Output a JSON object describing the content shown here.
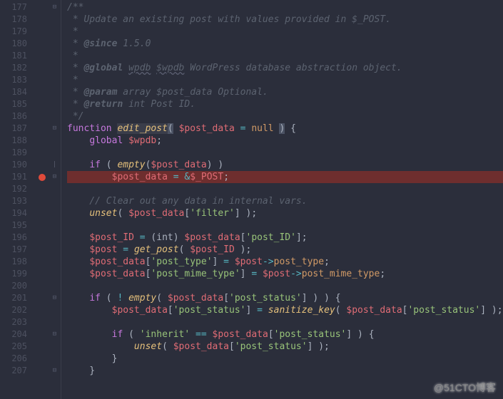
{
  "watermark": "@51CTO博客",
  "gutter": {
    "start": 177,
    "end": 207,
    "breakpoint_lines": [
      191
    ],
    "fold_markers": {
      "177": "⊟",
      "187": "⊟",
      "190": "|",
      "191": "⊟",
      "201": "⊟",
      "204": "⊟",
      "207": "⊟"
    }
  },
  "code": {
    "177": [
      {
        "c": "c-comment",
        "t": "/**"
      }
    ],
    "178": [
      {
        "c": "c-comment",
        "t": " * Update an existing post with values provided in $_POST."
      }
    ],
    "179": [
      {
        "c": "c-comment",
        "t": " *"
      }
    ],
    "180": [
      {
        "c": "c-comment",
        "t": " * "
      },
      {
        "c": "c-tag",
        "t": "@since"
      },
      {
        "c": "c-comment",
        "t": " 1.5.0"
      }
    ],
    "181": [
      {
        "c": "c-comment",
        "t": " *"
      }
    ],
    "182": [
      {
        "c": "c-comment",
        "t": " * "
      },
      {
        "c": "c-tag",
        "t": "@global"
      },
      {
        "c": "c-comment",
        "t": " "
      },
      {
        "c": "c-comment underline",
        "t": "wpdb"
      },
      {
        "c": "c-comment",
        "t": " "
      },
      {
        "c": "c-comment underline",
        "t": "$wpdb"
      },
      {
        "c": "c-comment",
        "t": " WordPress database abstraction object."
      }
    ],
    "183": [
      {
        "c": "c-comment",
        "t": " *"
      }
    ],
    "184": [
      {
        "c": "c-comment",
        "t": " * "
      },
      {
        "c": "c-tag",
        "t": "@param"
      },
      {
        "c": "c-comment",
        "t": " array $post_data Optional."
      }
    ],
    "185": [
      {
        "c": "c-comment",
        "t": " * "
      },
      {
        "c": "c-tag",
        "t": "@return"
      },
      {
        "c": "c-comment",
        "t": " int Post ID."
      }
    ],
    "186": [
      {
        "c": "c-comment",
        "t": " */"
      }
    ],
    "187": [
      {
        "c": "c-kw",
        "t": "function"
      },
      {
        "c": "c-punc",
        "t": " "
      },
      {
        "c": "c-fnname",
        "t": "edit_post"
      },
      {
        "c": "c-punc c-paren-hl",
        "t": "("
      },
      {
        "c": "c-punc",
        "t": " "
      },
      {
        "c": "c-var",
        "t": "$post_data"
      },
      {
        "c": "c-punc",
        "t": " "
      },
      {
        "c": "c-op",
        "t": "="
      },
      {
        "c": "c-punc",
        "t": " "
      },
      {
        "c": "c-null",
        "t": "null"
      },
      {
        "c": "c-punc",
        "t": " "
      },
      {
        "c": "c-punc c-paren-hl",
        "t": ")"
      },
      {
        "c": "c-punc",
        "t": " {"
      }
    ],
    "188": [
      {
        "c": "c-punc",
        "t": "    "
      },
      {
        "c": "c-kw",
        "t": "global"
      },
      {
        "c": "c-punc",
        "t": " "
      },
      {
        "c": "c-var",
        "t": "$wpdb"
      },
      {
        "c": "c-punc",
        "t": ";"
      }
    ],
    "189": [],
    "190": [
      {
        "c": "c-punc",
        "t": "    "
      },
      {
        "c": "c-kw",
        "t": "if"
      },
      {
        "c": "c-punc",
        "t": " ( "
      },
      {
        "c": "c-fn",
        "t": "empty"
      },
      {
        "c": "c-punc",
        "t": "("
      },
      {
        "c": "c-var",
        "t": "$post_data"
      },
      {
        "c": "c-punc",
        "t": ") )"
      }
    ],
    "191": [
      {
        "c": "c-punc",
        "t": "        "
      },
      {
        "c": "c-var",
        "t": "$post_data"
      },
      {
        "c": "c-punc",
        "t": " "
      },
      {
        "c": "c-op",
        "t": "="
      },
      {
        "c": "c-punc",
        "t": " "
      },
      {
        "c": "c-op",
        "t": "&"
      },
      {
        "c": "c-var",
        "t": "$_POST"
      },
      {
        "c": "c-punc",
        "t": ";"
      }
    ],
    "192": [],
    "193": [
      {
        "c": "c-comment",
        "t": "    // Clear out any data in internal vars."
      }
    ],
    "194": [
      {
        "c": "c-punc",
        "t": "    "
      },
      {
        "c": "c-fn",
        "t": "unset"
      },
      {
        "c": "c-punc",
        "t": "( "
      },
      {
        "c": "c-var",
        "t": "$post_data"
      },
      {
        "c": "c-punc",
        "t": "["
      },
      {
        "c": "c-str",
        "t": "'filter'"
      },
      {
        "c": "c-punc",
        "t": "] );"
      }
    ],
    "195": [],
    "196": [
      {
        "c": "c-punc",
        "t": "    "
      },
      {
        "c": "c-var",
        "t": "$post_ID"
      },
      {
        "c": "c-punc",
        "t": " "
      },
      {
        "c": "c-op",
        "t": "="
      },
      {
        "c": "c-punc",
        "t": " (int) "
      },
      {
        "c": "c-var",
        "t": "$post_data"
      },
      {
        "c": "c-punc",
        "t": "["
      },
      {
        "c": "c-str",
        "t": "'post_ID'"
      },
      {
        "c": "c-punc",
        "t": "];"
      }
    ],
    "197": [
      {
        "c": "c-punc",
        "t": "    "
      },
      {
        "c": "c-var",
        "t": "$post"
      },
      {
        "c": "c-punc",
        "t": " "
      },
      {
        "c": "c-op",
        "t": "="
      },
      {
        "c": "c-punc",
        "t": " "
      },
      {
        "c": "c-fn",
        "t": "get_post"
      },
      {
        "c": "c-punc",
        "t": "( "
      },
      {
        "c": "c-var",
        "t": "$post_ID"
      },
      {
        "c": "c-punc",
        "t": " );"
      }
    ],
    "198": [
      {
        "c": "c-punc",
        "t": "    "
      },
      {
        "c": "c-var",
        "t": "$post_data"
      },
      {
        "c": "c-punc",
        "t": "["
      },
      {
        "c": "c-str",
        "t": "'post_type'"
      },
      {
        "c": "c-punc",
        "t": "] "
      },
      {
        "c": "c-op",
        "t": "="
      },
      {
        "c": "c-punc",
        "t": " "
      },
      {
        "c": "c-var",
        "t": "$post"
      },
      {
        "c": "c-op",
        "t": "->"
      },
      {
        "c": "c-var2",
        "t": "post_type"
      },
      {
        "c": "c-punc",
        "t": ";"
      }
    ],
    "199": [
      {
        "c": "c-punc",
        "t": "    "
      },
      {
        "c": "c-var",
        "t": "$post_data"
      },
      {
        "c": "c-punc",
        "t": "["
      },
      {
        "c": "c-str",
        "t": "'post_mime_type'"
      },
      {
        "c": "c-punc",
        "t": "] "
      },
      {
        "c": "c-op",
        "t": "="
      },
      {
        "c": "c-punc",
        "t": " "
      },
      {
        "c": "c-var",
        "t": "$post"
      },
      {
        "c": "c-op",
        "t": "->"
      },
      {
        "c": "c-var2",
        "t": "post_mime_type"
      },
      {
        "c": "c-punc",
        "t": ";"
      }
    ],
    "200": [],
    "201": [
      {
        "c": "c-punc",
        "t": "    "
      },
      {
        "c": "c-kw",
        "t": "if"
      },
      {
        "c": "c-punc",
        "t": " ( "
      },
      {
        "c": "c-op",
        "t": "!"
      },
      {
        "c": "c-punc",
        "t": " "
      },
      {
        "c": "c-fn",
        "t": "empty"
      },
      {
        "c": "c-punc",
        "t": "( "
      },
      {
        "c": "c-var",
        "t": "$post_data"
      },
      {
        "c": "c-punc",
        "t": "["
      },
      {
        "c": "c-str",
        "t": "'post_status'"
      },
      {
        "c": "c-punc",
        "t": "] ) ) {"
      }
    ],
    "202": [
      {
        "c": "c-punc",
        "t": "        "
      },
      {
        "c": "c-var",
        "t": "$post_data"
      },
      {
        "c": "c-punc",
        "t": "["
      },
      {
        "c": "c-str",
        "t": "'post_status'"
      },
      {
        "c": "c-punc",
        "t": "] "
      },
      {
        "c": "c-op",
        "t": "="
      },
      {
        "c": "c-punc",
        "t": " "
      },
      {
        "c": "c-fn",
        "t": "sanitize_key"
      },
      {
        "c": "c-punc",
        "t": "( "
      },
      {
        "c": "c-var",
        "t": "$post_data"
      },
      {
        "c": "c-punc",
        "t": "["
      },
      {
        "c": "c-str",
        "t": "'post_status'"
      },
      {
        "c": "c-punc",
        "t": "] );"
      }
    ],
    "203": [],
    "204": [
      {
        "c": "c-punc",
        "t": "        "
      },
      {
        "c": "c-kw",
        "t": "if"
      },
      {
        "c": "c-punc",
        "t": " ( "
      },
      {
        "c": "c-str",
        "t": "'inherit'"
      },
      {
        "c": "c-punc",
        "t": " "
      },
      {
        "c": "c-op",
        "t": "=="
      },
      {
        "c": "c-punc",
        "t": " "
      },
      {
        "c": "c-var",
        "t": "$post_data"
      },
      {
        "c": "c-punc",
        "t": "["
      },
      {
        "c": "c-str",
        "t": "'post_status'"
      },
      {
        "c": "c-punc",
        "t": "] ) {"
      }
    ],
    "205": [
      {
        "c": "c-punc",
        "t": "            "
      },
      {
        "c": "c-fn",
        "t": "unset"
      },
      {
        "c": "c-punc",
        "t": "( "
      },
      {
        "c": "c-var",
        "t": "$post_data"
      },
      {
        "c": "c-punc",
        "t": "["
      },
      {
        "c": "c-str",
        "t": "'post_status'"
      },
      {
        "c": "c-punc",
        "t": "] );"
      }
    ],
    "206": [
      {
        "c": "c-punc",
        "t": "        }"
      }
    ],
    "207": [
      {
        "c": "c-punc",
        "t": "    }"
      }
    ]
  },
  "error_lines": [
    191
  ]
}
